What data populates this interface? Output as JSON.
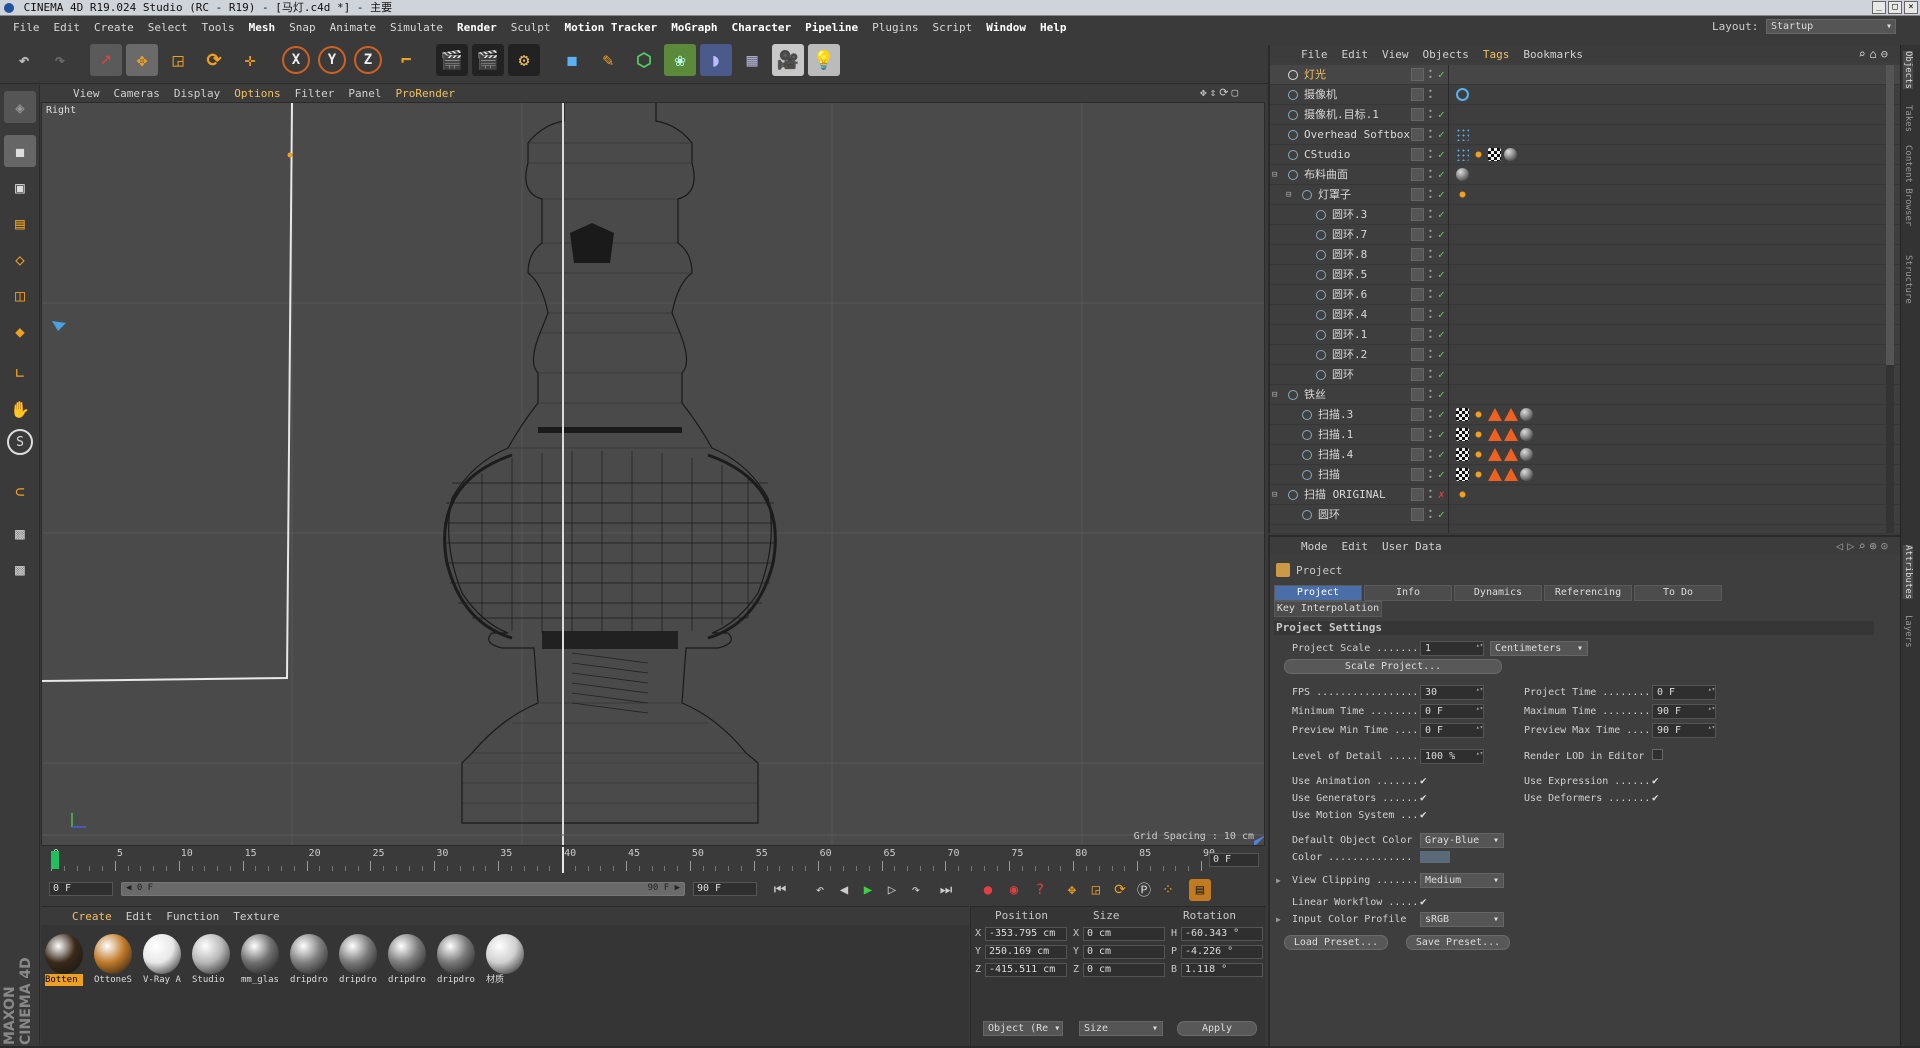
{
  "window": {
    "title": "CINEMA 4D R19.024 Studio (RC - R19) - [马灯.c4d *] - 主要",
    "layout_label": "Layout:",
    "layout_value": "Startup"
  },
  "menu": [
    "File",
    "Edit",
    "Create",
    "Select",
    "Tools",
    "Mesh",
    "Snap",
    "Animate",
    "Simulate",
    "Render",
    "Sculpt",
    "Motion Tracker",
    "MoGraph",
    "Character",
    "Pipeline",
    "Plugins",
    "Script",
    "Window",
    "Help"
  ],
  "viewport": {
    "menu": [
      "View",
      "Cameras",
      "Display",
      "Options",
      "Filter",
      "Panel",
      "ProRender"
    ],
    "view_name": "Right",
    "grid_spacing": "Grid Spacing : 10 cm"
  },
  "timeline": {
    "ticks": [
      "0",
      "5",
      "10",
      "15",
      "20",
      "25",
      "30",
      "35",
      "40",
      "45",
      "50",
      "55",
      "60",
      "65",
      "70",
      "75",
      "80",
      "85",
      "90"
    ],
    "current_frame": "0 F",
    "start_field": "0 F",
    "range_start": "◀ 0 F",
    "range_end": "90 F ▶",
    "end_field": "90 F",
    "playhead_frame": 40,
    "max_frame": 90
  },
  "materials": {
    "menu": [
      "Create",
      "Edit",
      "Function",
      "Texture"
    ],
    "items": [
      {
        "label": "Botten",
        "color": "#3a2a1a"
      },
      {
        "label": "OttoneS",
        "color": "#c07a2a"
      },
      {
        "label": "V-Ray A",
        "color": "#e8e8e8"
      },
      {
        "label": "Studio",
        "color": "#b8b8b8"
      },
      {
        "label": "mm_glas",
        "color": "#707070"
      },
      {
        "label": "dripdro",
        "color": "#808080"
      },
      {
        "label": "dripdro",
        "color": "#7a7a7a"
      },
      {
        "label": "dripdro",
        "color": "#7c7c7c"
      },
      {
        "label": "dripdro",
        "color": "#787878"
      },
      {
        "label": "材质",
        "color": "#d0d0d0"
      }
    ]
  },
  "coords": {
    "headers": [
      "Position",
      "Size",
      "Rotation"
    ],
    "rows": [
      {
        "axis": "X",
        "pos": "-353.795 cm",
        "size_axis": "X",
        "size": "0 cm",
        "rot_axis": "H",
        "rot": "-60.343 °"
      },
      {
        "axis": "Y",
        "pos": "250.169 cm",
        "size_axis": "Y",
        "size": "0 cm",
        "rot_axis": "P",
        "rot": "-4.226 °"
      },
      {
        "axis": "Z",
        "pos": "-415.511 cm",
        "size_axis": "Z",
        "size": "0 cm",
        "rot_axis": "B",
        "rot": "1.118 °"
      }
    ],
    "mode_dd": "Object (Re",
    "size_dd": "Size",
    "apply": "Apply"
  },
  "objects": {
    "menu": [
      "File",
      "Edit",
      "View",
      "Objects",
      "Tags",
      "Bookmarks"
    ],
    "rows": [
      {
        "name": "灯光",
        "indent": 0,
        "hl": true
      },
      {
        "name": "摄像机",
        "indent": 0
      },
      {
        "name": "摄像机.目标.1",
        "indent": 0
      },
      {
        "name": "Overhead Softbox",
        "indent": 0
      },
      {
        "name": "CStudio",
        "indent": 0
      },
      {
        "name": "布料曲面",
        "indent": 0
      },
      {
        "name": "灯罩子",
        "indent": 1
      },
      {
        "name": "圆环.3",
        "indent": 2
      },
      {
        "name": "圆环.7",
        "indent": 2
      },
      {
        "name": "圆环.8",
        "indent": 2
      },
      {
        "name": "圆环.5",
        "indent": 2
      },
      {
        "name": "圆环.6",
        "indent": 2
      },
      {
        "name": "圆环.4",
        "indent": 2
      },
      {
        "name": "圆环.1",
        "indent": 2
      },
      {
        "name": "圆环.2",
        "indent": 2
      },
      {
        "name": "圆环",
        "indent": 2
      },
      {
        "name": "铁丝",
        "indent": 0
      },
      {
        "name": "扫描.3",
        "indent": 1
      },
      {
        "name": "扫描.1",
        "indent": 1
      },
      {
        "name": "扫描.4",
        "indent": 1
      },
      {
        "name": "扫描",
        "indent": 1
      },
      {
        "name": "扫描 ORIGINAL",
        "indent": 0
      },
      {
        "name": "圆环",
        "indent": 1
      }
    ]
  },
  "attributes": {
    "menu": [
      "Mode",
      "Edit",
      "User Data"
    ],
    "title": "Project",
    "tabs": [
      "Project Settings",
      "Info",
      "Dynamics",
      "Referencing",
      "To Do"
    ],
    "tab2": "Key Interpolation",
    "section": "Project Settings",
    "project_scale_label": "Project Scale ........",
    "project_scale": "1",
    "scale_unit": "Centimeters",
    "scale_project_btn": "Scale Project...",
    "fps_label": "FPS .................",
    "fps": "30",
    "project_time_label": "Project Time .........",
    "project_time": "0 F",
    "min_time_label": "Minimum Time .........",
    "min_time": "0 F",
    "max_time_label": "Maximum Time .........",
    "max_time": "90 F",
    "prev_min_label": "Preview Min Time .....",
    "prev_min": "0 F",
    "prev_max_label": "Preview Max Time .....",
    "prev_max": "90 F",
    "lod_label": "Level of Detail .....",
    "lod": "100 %",
    "render_lod_label": "Render LOD in Editor",
    "use_anim": "Use Animation .......",
    "use_expr": "Use Expression ......",
    "use_gen": "Use Generators ......",
    "use_def": "Use Deformers .......",
    "use_motion": "Use Motion System ...",
    "def_color_label": "Default Object Color",
    "def_color": "Gray-Blue",
    "color_label": "Color ..............",
    "view_clip_label": "View Clipping .......",
    "view_clip": "Medium",
    "linear_label": "Linear Workflow .....",
    "input_profile_label": "Input Color Profile",
    "input_profile": "sRGB",
    "load_preset": "Load Preset...",
    "save_preset": "Save Preset..."
  },
  "side_tabs": [
    "Objects",
    "Takes",
    "Content Browser",
    "Structure",
    "Attributes",
    "Layers"
  ],
  "colors": {
    "accent": "#f0c060",
    "check": "#5fd35f",
    "active_tab": "#4a6ea8"
  }
}
